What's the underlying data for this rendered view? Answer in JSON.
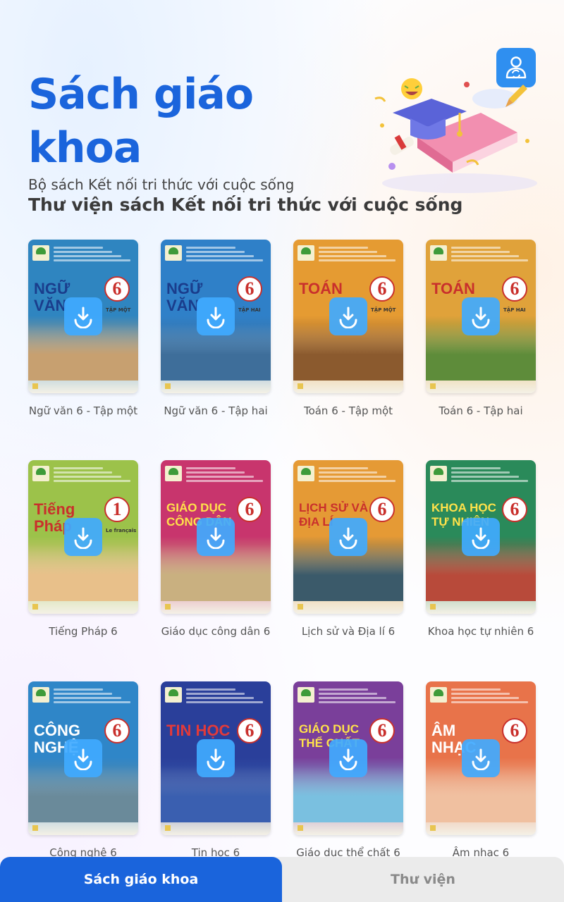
{
  "header": {
    "title": "Sách giáo khoa",
    "subtitle": "Bộ sách Kết nối tri thức với cuộc sống"
  },
  "profile_button": {
    "icon": "user-switch-icon"
  },
  "hero": {
    "icon": "graduation-book-illustration"
  },
  "library": {
    "section_title": "Thư viện sách Kết nối tri thức với cuộc sống",
    "download_icon": "download-icon",
    "books": [
      {
        "label": "Ngữ văn 6 - Tập một",
        "cover_title": "NGỮ VĂN",
        "grade": "6",
        "volume": "TẬP MỘT",
        "bg": "#2f85c0",
        "title_color": "#1a3d8c",
        "scene": "#c7a070"
      },
      {
        "label": "Ngữ văn 6 - Tập hai",
        "cover_title": "NGỮ VĂN",
        "grade": "6",
        "volume": "TẬP HAI",
        "bg": "#2f80c8",
        "title_color": "#1a3d8c",
        "scene": "#3e6e9a"
      },
      {
        "label": "Toán 6 - Tập một",
        "cover_title": "TOÁN",
        "grade": "6",
        "volume": "TẬP MỘT",
        "bg": "#e59b32",
        "title_color": "#c9302c",
        "scene": "#8b5a2e"
      },
      {
        "label": "Toán 6 - Tập hai",
        "cover_title": "TOÁN",
        "grade": "6",
        "volume": "TẬP HAI",
        "bg": "#e0a23a",
        "title_color": "#c9302c",
        "scene": "#5e8c3a"
      },
      {
        "label": "Tiếng Pháp 6",
        "cover_title": "Tiếng Pháp",
        "grade": "1",
        "volume": "Le français",
        "bg": "#9cc24a",
        "title_color": "#c9302c",
        "scene": "#e8c08a"
      },
      {
        "label": "Giáo dục công dân 6",
        "cover_title": "GIÁO DỤC CÔNG DÂN",
        "grade": "6",
        "volume": "",
        "bg": "#c8356d",
        "title_color": "#ffe24a",
        "scene": "#c9b080"
      },
      {
        "label": "Lịch sử và Địa lí 6",
        "cover_title": "LỊCH SỬ VÀ ĐỊA LÍ",
        "grade": "6",
        "volume": "",
        "bg": "#e59a35",
        "title_color": "#c9302c",
        "scene": "#3b5a6a"
      },
      {
        "label": "Khoa học tự nhiên 6",
        "cover_title": "KHOA HỌC TỰ NHIÊN",
        "grade": "6",
        "volume": "",
        "bg": "#2a8a5a",
        "title_color": "#ffe24a",
        "scene": "#b84a3a"
      },
      {
        "label": "Công nghệ 6",
        "cover_title": "CÔNG NGHỆ",
        "grade": "6",
        "volume": "",
        "bg": "#2f86c8",
        "title_color": "#ffffff",
        "scene": "#6a8a9a"
      },
      {
        "label": "Tin học 6",
        "cover_title": "TIN HỌC",
        "grade": "6",
        "volume": "",
        "bg": "#2a3f9a",
        "title_color": "#e23a3a",
        "scene": "#3a5fb0"
      },
      {
        "label": "Giáo dục thể chất 6",
        "cover_title": "GIÁO DỤC THỂ CHẤT",
        "grade": "6",
        "volume": "",
        "bg": "#7a3f9a",
        "title_color": "#ffe24a",
        "scene": "#7ac0e0"
      },
      {
        "label": "Âm nhạc 6",
        "cover_title": "ÂM NHẠC",
        "grade": "6",
        "volume": "",
        "bg": "#e8734a",
        "title_color": "#ffffff",
        "scene": "#f0c0a0"
      }
    ]
  },
  "bottom_nav": {
    "tabs": [
      {
        "label": "Sách giáo khoa",
        "active": true
      },
      {
        "label": "Thư viện",
        "active": false
      }
    ]
  },
  "colors": {
    "primary": "#1a64dc",
    "download_button": "#40aaff",
    "profile_button": "#2f8ff0"
  }
}
